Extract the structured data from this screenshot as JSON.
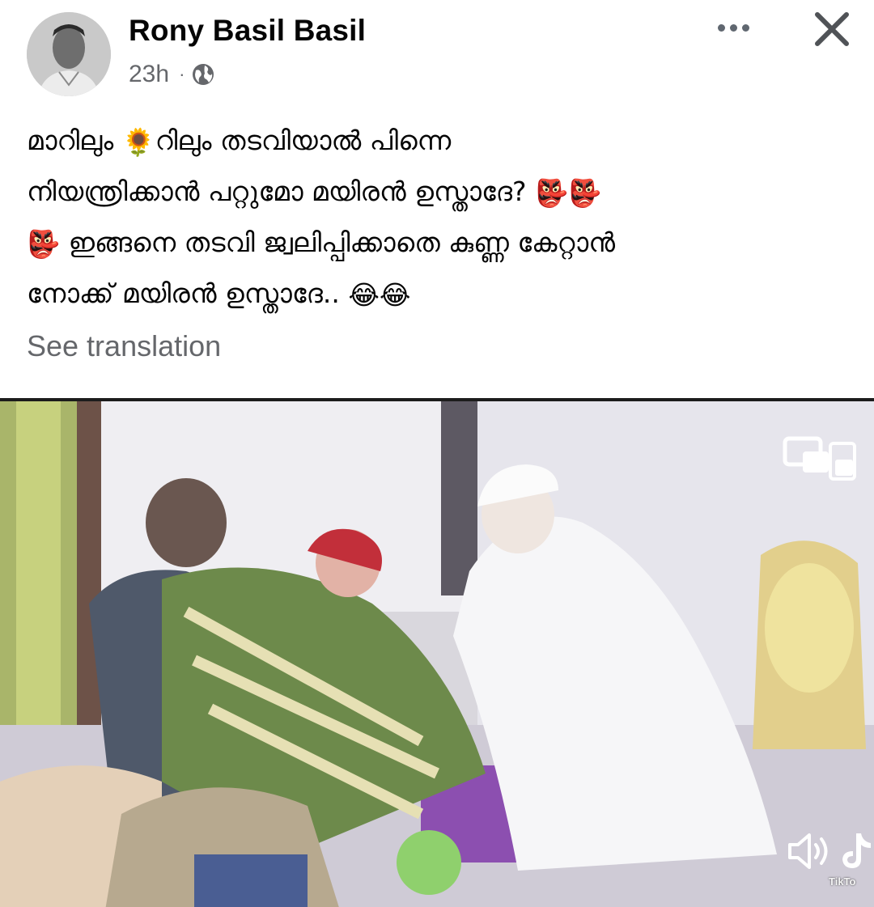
{
  "post": {
    "author": "Rony Basil Basil",
    "time": "23h",
    "separator": "·",
    "audience_icon": "globe-icon",
    "text_lines": [
      [
        "മാറിലും ",
        "🌻",
        "റിലും  തടവിയാൽ പിന്നെ"
      ],
      [
        "നിയന്ത്രിക്കാൻ പറ്റുമോ മയിരൻ ഉസ്താദേ? ",
        "👺👺"
      ],
      [
        "👺",
        " ഇങ്ങനെ തടവി ജ്വലിപ്പിക്കാതെ കുണ്ണ കേറ്റാൻ"
      ],
      [
        "നോക്ക് മയിരൻ ഉസ്താദേ.. ",
        "😂😂"
      ]
    ],
    "see_translation": "See translation"
  },
  "media": {
    "type": "video",
    "overlay_icons": [
      "picture-in-picture-icon",
      "volume-icon",
      "tiktok-logo-icon"
    ],
    "watermark": "TikTo"
  },
  "colors": {
    "primary_text": "#050505",
    "secondary_text": "#65676b",
    "background": "#ffffff"
  }
}
